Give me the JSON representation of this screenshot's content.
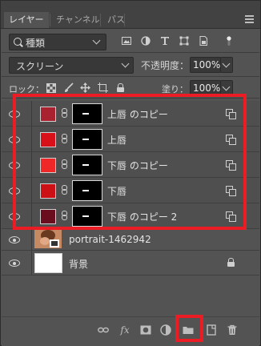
{
  "tabs": [
    {
      "label": "レイヤー",
      "active": true
    },
    {
      "label": "チャンネル",
      "active": false
    },
    {
      "label": "パス",
      "active": false
    }
  ],
  "filter": {
    "kind_label": "種類"
  },
  "blend": {
    "mode": "スクリーン",
    "opacity_label": "不透明度：",
    "opacity_value": "100%"
  },
  "lock": {
    "label": "ロック：",
    "fill_label": "塗り：",
    "fill_value": "100%"
  },
  "layers": [
    {
      "name": "上唇 のコピー",
      "color": "#a8232f"
    },
    {
      "name": "上唇",
      "color": "#d8101a"
    },
    {
      "name": "下唇 のコピー",
      "color": "#ef2727"
    },
    {
      "name": "下唇",
      "color": "#cc1015"
    },
    {
      "name": "下唇 のコピー 2",
      "color": "#6a0d1e"
    }
  ],
  "photo_layer": {
    "name": "portrait-1462942"
  },
  "background_layer": {
    "name": "背景"
  },
  "highlight_color": "#ec1c24",
  "icons": [
    "search-icon",
    "image-filter-icon",
    "adjustment-filter-icon",
    "type-filter-icon",
    "shape-filter-icon",
    "smartobject-filter-icon",
    "filter-toggle-icon",
    "lock-pixels-icon",
    "lock-image-icon",
    "lock-position-icon",
    "lock-artboard-icon",
    "lock-all-icon",
    "link-layers-icon",
    "fx-icon",
    "add-mask-icon",
    "adjustment-layer-icon",
    "new-group-icon",
    "new-layer-icon",
    "trash-icon"
  ]
}
